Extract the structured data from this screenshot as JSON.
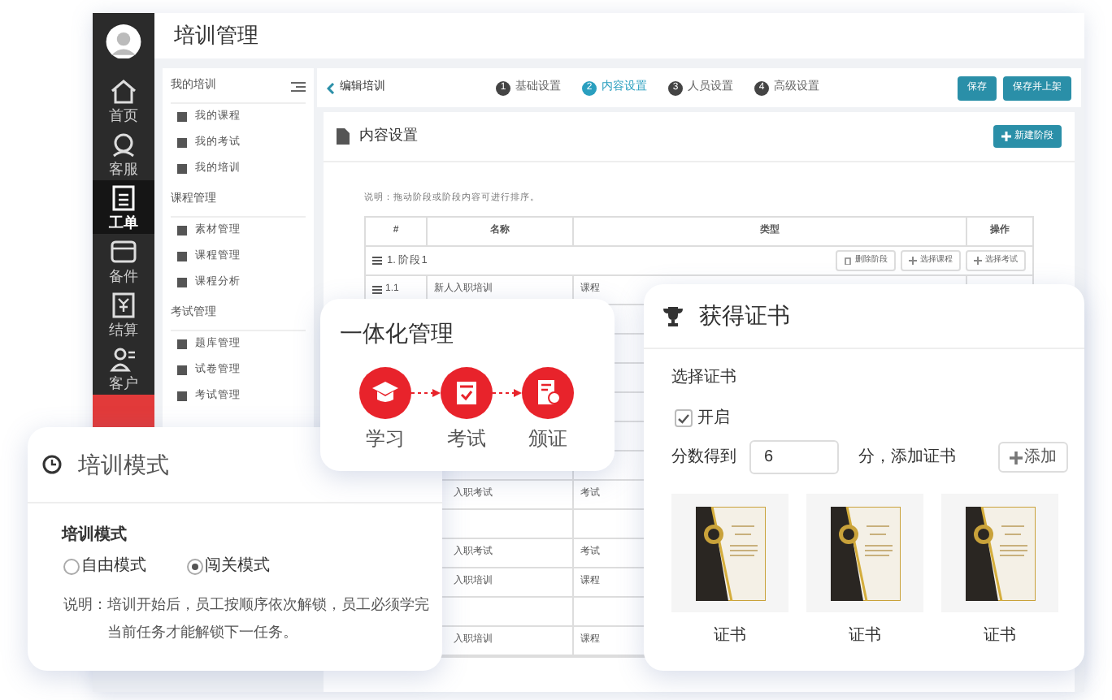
{
  "app": {
    "title": "培训管理",
    "nav": [
      {
        "label": "首页",
        "selected": false
      },
      {
        "label": "客服",
        "selected": false
      },
      {
        "label": "工单",
        "selected": true
      },
      {
        "label": "备件",
        "selected": false
      },
      {
        "label": "结算",
        "selected": false
      },
      {
        "label": "客户",
        "selected": false
      }
    ],
    "menu_groups": [
      {
        "title": "我的培训",
        "items": [
          "我的课程",
          "我的考试",
          "我的培训"
        ]
      },
      {
        "title": "课程管理",
        "items": [
          "素材管理",
          "课程管理",
          "课程分析"
        ]
      },
      {
        "title": "考试管理",
        "items": [
          "题库管理",
          "试卷管理",
          "考试管理"
        ]
      }
    ],
    "back_link": "编辑培训",
    "steps": [
      {
        "number": "1",
        "label": "基础设置",
        "selected": false
      },
      {
        "number": "2",
        "label": "内容设置",
        "selected": true
      },
      {
        "number": "3",
        "label": "人员设置",
        "selected": false
      },
      {
        "number": "4",
        "label": "高级设置",
        "selected": false
      }
    ],
    "buttons": [
      "保存",
      "保存并上架"
    ],
    "panel": {
      "title": "内容设置",
      "new_button": "新建阶段",
      "note": "说明：拖动阶段或阶段内容可进行排序。",
      "table": {
        "columns": [
          "#",
          "名称",
          "类型",
          "操作"
        ],
        "stage": {
          "name": "1. 阶段1",
          "actions": [
            "删除阶段",
            "选择课程",
            "选择考试"
          ]
        },
        "rows": [
          {
            "kind": "item",
            "number": "1.1",
            "name": "新人入职培训",
            "type": "课程"
          },
          {
            "kind": "hidden"
          },
          {
            "kind": "hidden"
          },
          {
            "kind": "hidden"
          },
          {
            "kind": "hidden"
          },
          {
            "kind": "hidden"
          },
          {
            "kind": "hidden"
          },
          {
            "kind": "item",
            "name": "入职考试",
            "type": "考试"
          },
          {
            "kind": "hidden"
          },
          {
            "kind": "item",
            "name": "入职考试",
            "type": "考试"
          },
          {
            "kind": "item",
            "name": "入职培训",
            "type": "课程"
          },
          {
            "kind": "hidden"
          },
          {
            "kind": "item",
            "name": "入职培训",
            "type": "课程"
          }
        ]
      }
    }
  },
  "flow_card": {
    "title": "一体化管理",
    "steps": [
      "学习",
      "考试",
      "颁证"
    ]
  },
  "certificate_card": {
    "title": "获得证书",
    "section": "选择证书",
    "enable": {
      "label": "开启",
      "checked": true
    },
    "score_label": "分数得到",
    "score": "6",
    "score_suffix": "分，添加证书",
    "add_button": "添加",
    "certificates": [
      "证书",
      "证书",
      "证书"
    ]
  },
  "mode_card": {
    "title": "培训模式",
    "field_label": "培训模式",
    "options": [
      {
        "label": "自由模式",
        "selected": false
      },
      {
        "label": "闯关模式",
        "selected": true
      }
    ],
    "note_label": "说明：",
    "note": "培训开始后，员工按顺序依次解锁，员工必须学完当前任务才能解锁下一任务。"
  }
}
